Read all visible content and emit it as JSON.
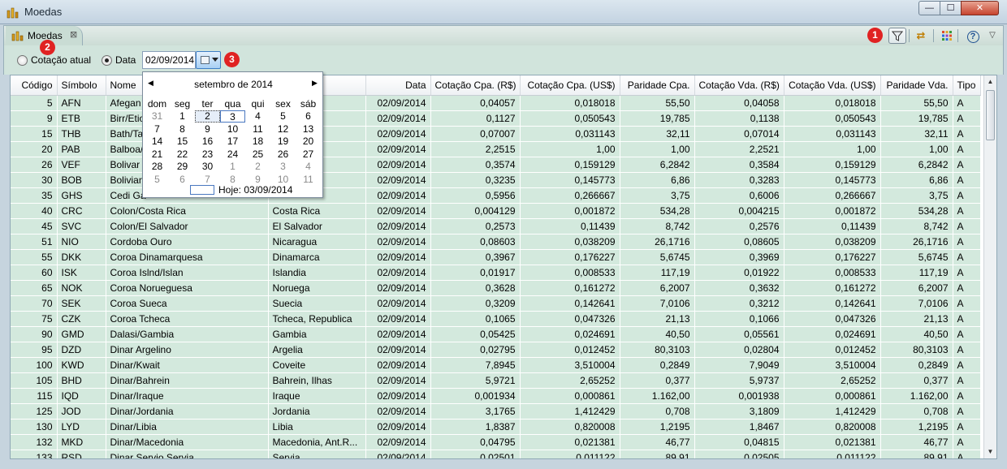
{
  "window": {
    "title": "Moedas",
    "close_symbol": "✕",
    "min_symbol": "—",
    "max_symbol": "☐"
  },
  "tab": {
    "label": "Moedas",
    "close_symbol": "⊠"
  },
  "toolbar": {
    "help_symbol": "?",
    "menu_symbol": "▽",
    "refresh_symbol": "⇄",
    "filter_symbol": "▽"
  },
  "badges": [
    "1",
    "2",
    "3"
  ],
  "options": {
    "current_label": "Cotação atual",
    "date_label": "Data",
    "date_value": "02/09/2014"
  },
  "calendar": {
    "month_label": "setembro de 2014",
    "days_of_week": [
      "dom",
      "seg",
      "ter",
      "qua",
      "qui",
      "sex",
      "sáb"
    ],
    "weeks": [
      [
        "31",
        "1",
        "2",
        "3",
        "4",
        "5",
        "6"
      ],
      [
        "7",
        "8",
        "9",
        "10",
        "11",
        "12",
        "13"
      ],
      [
        "14",
        "15",
        "16",
        "17",
        "18",
        "19",
        "20"
      ],
      [
        "21",
        "22",
        "23",
        "24",
        "25",
        "26",
        "27"
      ],
      [
        "28",
        "29",
        "30",
        "1",
        "2",
        "3",
        "4"
      ],
      [
        "5",
        "6",
        "7",
        "8",
        "9",
        "10",
        "11"
      ]
    ],
    "today_label": "Hoje: 03/09/2014"
  },
  "table": {
    "headers": [
      "Código",
      "Símbolo",
      "Nome",
      "",
      "Data",
      "Cotação Cpa. (R$)",
      "Cotação Cpa. (US$)",
      "Paridade Cpa.",
      "Cotação Vda. (R$)",
      "Cotação Vda. (US$)",
      "Paridade Vda.",
      "Tipo"
    ],
    "rows": [
      [
        "5",
        "AFN",
        "Afegan",
        "",
        "02/09/2014",
        "0,04057",
        "0,018018",
        "55,50",
        "0,04058",
        "0,018018",
        "55,50",
        "A"
      ],
      [
        "9",
        "ETB",
        "Birr/Etio",
        "",
        "02/09/2014",
        "0,1127",
        "0,050543",
        "19,785",
        "0,1138",
        "0,050543",
        "19,785",
        "A"
      ],
      [
        "15",
        "THB",
        "Bath/Ta",
        "",
        "02/09/2014",
        "0,07007",
        "0,031143",
        "32,11",
        "0,07014",
        "0,031143",
        "32,11",
        "A"
      ],
      [
        "20",
        "PAB",
        "Balboa/",
        "",
        "02/09/2014",
        "2,2515",
        "1,00",
        "1,00",
        "2,2521",
        "1,00",
        "1,00",
        "A"
      ],
      [
        "26",
        "VEF",
        "Bolivar",
        "",
        "02/09/2014",
        "0,3574",
        "0,159129",
        "6,2842",
        "0,3584",
        "0,159129",
        "6,2842",
        "A"
      ],
      [
        "30",
        "BOB",
        "Bolivian",
        "",
        "02/09/2014",
        "0,3235",
        "0,145773",
        "6,86",
        "0,3283",
        "0,145773",
        "6,86",
        "A"
      ],
      [
        "35",
        "GHS",
        "Cedi Ga",
        "",
        "02/09/2014",
        "0,5956",
        "0,266667",
        "3,75",
        "0,6006",
        "0,266667",
        "3,75",
        "A"
      ],
      [
        "40",
        "CRC",
        "Colon/Costa Rica",
        "Costa Rica",
        "02/09/2014",
        "0,004129",
        "0,001872",
        "534,28",
        "0,004215",
        "0,001872",
        "534,28",
        "A"
      ],
      [
        "45",
        "SVC",
        "Colon/El Salvador",
        "El Salvador",
        "02/09/2014",
        "0,2573",
        "0,11439",
        "8,742",
        "0,2576",
        "0,11439",
        "8,742",
        "A"
      ],
      [
        "51",
        "NIO",
        "Cordoba Ouro",
        "Nicaragua",
        "02/09/2014",
        "0,08603",
        "0,038209",
        "26,1716",
        "0,08605",
        "0,038209",
        "26,1716",
        "A"
      ],
      [
        "55",
        "DKK",
        "Coroa Dinamarquesa",
        "Dinamarca",
        "02/09/2014",
        "0,3967",
        "0,176227",
        "5,6745",
        "0,3969",
        "0,176227",
        "5,6745",
        "A"
      ],
      [
        "60",
        "ISK",
        "Coroa Islnd/Islan",
        "Islandia",
        "02/09/2014",
        "0,01917",
        "0,008533",
        "117,19",
        "0,01922",
        "0,008533",
        "117,19",
        "A"
      ],
      [
        "65",
        "NOK",
        "Coroa Norueguesa",
        "Noruega",
        "02/09/2014",
        "0,3628",
        "0,161272",
        "6,2007",
        "0,3632",
        "0,161272",
        "6,2007",
        "A"
      ],
      [
        "70",
        "SEK",
        "Coroa Sueca",
        "Suecia",
        "02/09/2014",
        "0,3209",
        "0,142641",
        "7,0106",
        "0,3212",
        "0,142641",
        "7,0106",
        "A"
      ],
      [
        "75",
        "CZK",
        "Coroa Tcheca",
        "Tcheca, Republica",
        "02/09/2014",
        "0,1065",
        "0,047326",
        "21,13",
        "0,1066",
        "0,047326",
        "21,13",
        "A"
      ],
      [
        "90",
        "GMD",
        "Dalasi/Gambia",
        "Gambia",
        "02/09/2014",
        "0,05425",
        "0,024691",
        "40,50",
        "0,05561",
        "0,024691",
        "40,50",
        "A"
      ],
      [
        "95",
        "DZD",
        "Dinar Argelino",
        "Argelia",
        "02/09/2014",
        "0,02795",
        "0,012452",
        "80,3103",
        "0,02804",
        "0,012452",
        "80,3103",
        "A"
      ],
      [
        "100",
        "KWD",
        "Dinar/Kwait",
        "Coveite",
        "02/09/2014",
        "7,8945",
        "3,510004",
        "0,2849",
        "7,9049",
        "3,510004",
        "0,2849",
        "A"
      ],
      [
        "105",
        "BHD",
        "Dinar/Bahrein",
        "Bahrein, Ilhas",
        "02/09/2014",
        "5,9721",
        "2,65252",
        "0,377",
        "5,9737",
        "2,65252",
        "0,377",
        "A"
      ],
      [
        "115",
        "IQD",
        "Dinar/Iraque",
        "Iraque",
        "02/09/2014",
        "0,001934",
        "0,000861",
        "1.162,00",
        "0,001938",
        "0,000861",
        "1.162,00",
        "A"
      ],
      [
        "125",
        "JOD",
        "Dinar/Jordania",
        "Jordania",
        "02/09/2014",
        "3,1765",
        "1,412429",
        "0,708",
        "3,1809",
        "1,412429",
        "0,708",
        "A"
      ],
      [
        "130",
        "LYD",
        "Dinar/Libia",
        "Libia",
        "02/09/2014",
        "1,8387",
        "0,820008",
        "1,2195",
        "1,8467",
        "0,820008",
        "1,2195",
        "A"
      ],
      [
        "132",
        "MKD",
        "Dinar/Macedonia",
        "Macedonia, Ant.R...",
        "02/09/2014",
        "0,04795",
        "0,021381",
        "46,77",
        "0,04815",
        "0,021381",
        "46,77",
        "A"
      ],
      [
        "133",
        "RSD",
        "Dinar Servio Servia",
        "Servia",
        "02/09/2014",
        "0,02501",
        "0,011122",
        "89,91",
        "0,02505",
        "0,011122",
        "89,91",
        "A"
      ]
    ]
  }
}
